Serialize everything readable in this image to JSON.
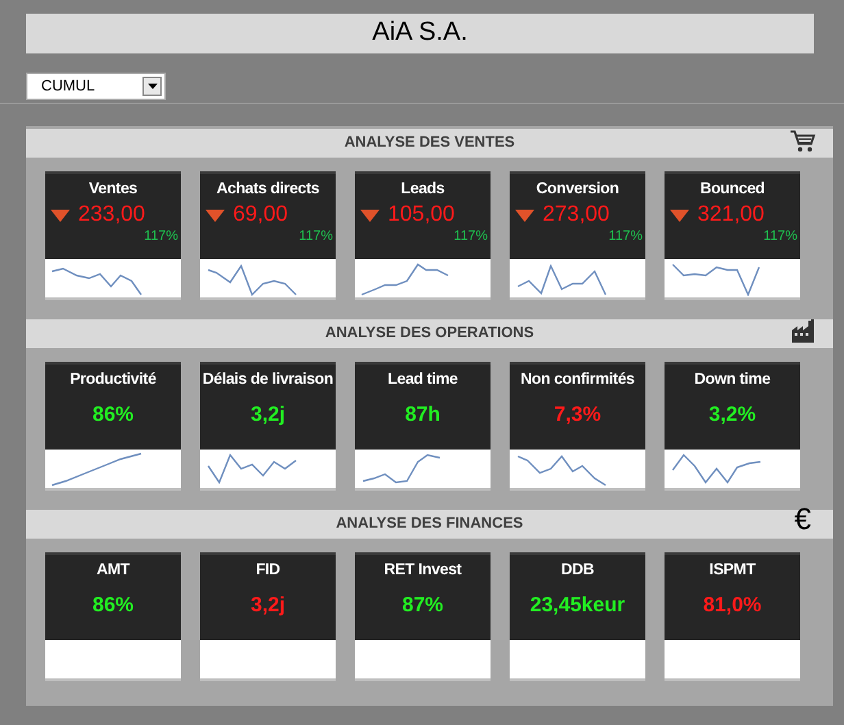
{
  "title": "AiA S.A.",
  "period_select": {
    "value": "CUMUL"
  },
  "sections": [
    {
      "title": "ANALYSE DES VENTES",
      "icon": {
        "kind": "cart"
      },
      "cards": [
        {
          "kind": "trend",
          "label": "Ventes",
          "value": "233,00",
          "alert": true,
          "trend_down": true,
          "ratio": "117%",
          "ratio_alert": false
        },
        {
          "kind": "trend",
          "label": "Achats directs",
          "value": "69,00",
          "alert": true,
          "trend_down": true,
          "ratio": "117%",
          "ratio_alert": false
        },
        {
          "kind": "trend",
          "label": "Leads",
          "value": "105,00",
          "alert": true,
          "trend_down": true,
          "ratio": "117%",
          "ratio_alert": false
        },
        {
          "kind": "trend",
          "label": "Conversion",
          "value": "273,00",
          "alert": true,
          "trend_down": true,
          "ratio": "117%",
          "ratio_alert": false
        },
        {
          "kind": "trend",
          "label": "Bounced",
          "value": "321,00",
          "alert": true,
          "trend_down": true,
          "ratio": "117%",
          "ratio_alert": false
        }
      ]
    },
    {
      "title": "ANALYSE DES OPERATIONS",
      "icon": {
        "kind": "factory"
      },
      "cards": [
        {
          "kind": "metric",
          "label": "Productivité",
          "value": "86%",
          "alert": false
        },
        {
          "kind": "metric",
          "label": "Délais de livraison",
          "value": "3,2j",
          "alert": false
        },
        {
          "kind": "metric",
          "label": "Lead time",
          "value": "87h",
          "alert": false
        },
        {
          "kind": "metric",
          "label": "Non confirmités",
          "value": "7,3%",
          "alert": true
        },
        {
          "kind": "metric",
          "label": "Down time",
          "value": "3,2%",
          "alert": false
        }
      ]
    },
    {
      "title": "ANALYSE DES FINANCES",
      "icon": {
        "kind": "glyph",
        "text": "€"
      },
      "cards": [
        {
          "kind": "metric",
          "label": "AMT",
          "value": "86%",
          "alert": false
        },
        {
          "kind": "metric",
          "label": "FID",
          "value": "3,2j",
          "alert": true
        },
        {
          "kind": "metric",
          "label": "RET Invest",
          "value": "87%",
          "alert": false
        },
        {
          "kind": "metric",
          "label": "DDB",
          "value": "23,45keur",
          "alert": false
        },
        {
          "kind": "metric",
          "label": "ISPMT",
          "value": "81,0%",
          "alert": true
        }
      ]
    }
  ]
}
